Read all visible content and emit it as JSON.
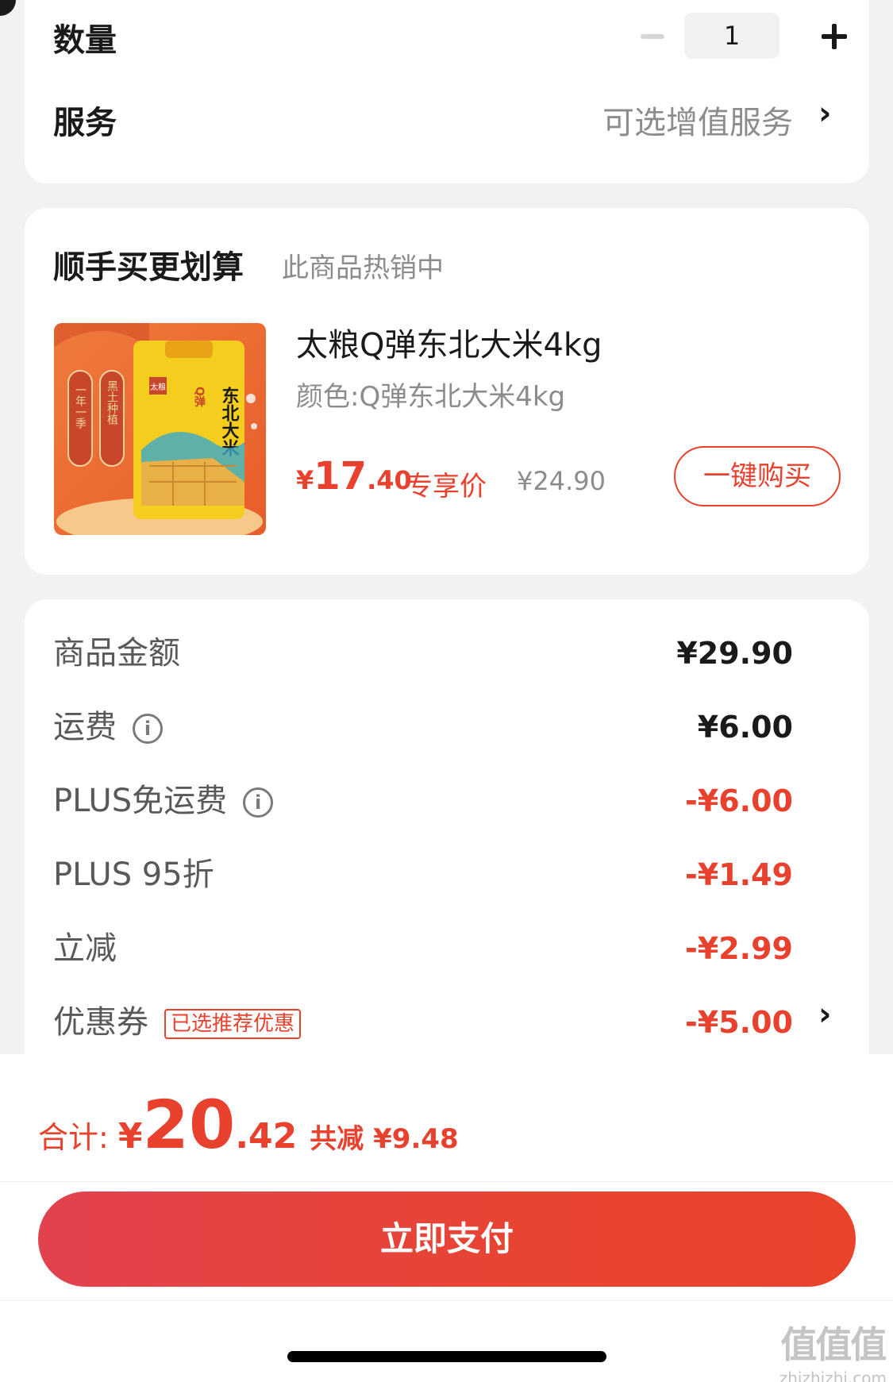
{
  "quantity": {
    "label": "数量",
    "value": "1"
  },
  "service": {
    "label": "服务",
    "value": "可选增值服务"
  },
  "bundle": {
    "title": "顺手买更划算",
    "subtitle": "此商品热销中",
    "product": {
      "name": "太粮Q弹东北大米4kg",
      "spec": "颜色:Q弹东北大米4kg",
      "price_yen": "¥",
      "price_int": "17",
      "price_dec": ".40",
      "price_tag": "专享价",
      "original_price": "¥24.90",
      "buy_label": "一键购买",
      "image_text": {
        "brand": "太粮",
        "title": "东北大米",
        "badge": "Q弹",
        "left_banner": "一年一季",
        "right_banner": "黑土种植"
      }
    }
  },
  "price_summary": {
    "rows": [
      {
        "label": "商品金额",
        "value": "¥29.90"
      },
      {
        "label": "运费",
        "value": "¥6.00"
      },
      {
        "label": "PLUS免运费",
        "value": "-¥6.00"
      },
      {
        "label": "PLUS 95折",
        "value": "-¥1.49"
      },
      {
        "label": "立减",
        "value": "-¥2.99"
      },
      {
        "label": "优惠券",
        "value": "-¥5.00",
        "tag": "已选推荐优惠"
      }
    ]
  },
  "footer": {
    "total_label": "合计:",
    "total_yen": "¥",
    "total_int": "20",
    "total_dec": ".42",
    "savings": "共减 ¥9.48",
    "pay_label": "立即支付"
  },
  "watermark": {
    "big": "值值值",
    "small": "zhizhizhi.com"
  },
  "colors": {
    "accent": "#e8412e",
    "text": "#1a1a1a",
    "muted": "#8c8c8c",
    "page_bg": "#f2f2f2"
  },
  "icons": [
    "minus-icon",
    "plus-icon",
    "chevron-right-icon",
    "info-icon"
  ]
}
